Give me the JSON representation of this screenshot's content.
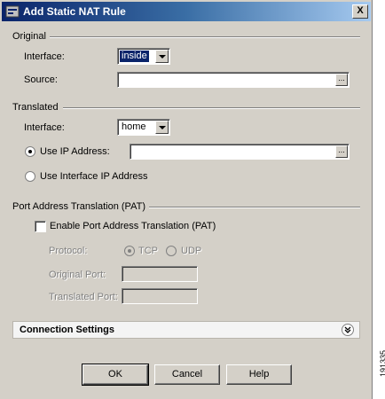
{
  "window": {
    "title": "Add Static NAT Rule",
    "close_label": "X"
  },
  "original": {
    "section_title": "Original",
    "interface_label": "Interface:",
    "interface_value": "inside",
    "source_label": "Source:",
    "source_value": "",
    "browse_label": "..."
  },
  "translated": {
    "section_title": "Translated",
    "interface_label": "Interface:",
    "interface_value": "home",
    "use_ip_label": "Use IP Address:",
    "use_ip_value": "",
    "use_ip_selected": true,
    "use_interface_ip_label": "Use Interface IP Address",
    "browse_label": "..."
  },
  "pat": {
    "section_title": "Port Address Translation (PAT)",
    "enable_label": "Enable Port Address Translation (PAT)",
    "enable_checked": false,
    "protocol_label": "Protocol:",
    "tcp_label": "TCP",
    "udp_label": "UDP",
    "protocol_selected": "TCP",
    "original_port_label": "Original Port:",
    "original_port_value": "",
    "translated_port_label": "Translated Port:",
    "translated_port_value": ""
  },
  "connection_settings": {
    "label": "Connection Settings",
    "expand_icon": "double-chevron-down-icon"
  },
  "buttons": {
    "ok": "OK",
    "cancel": "Cancel",
    "help": "Help"
  },
  "figure_id": "191335"
}
